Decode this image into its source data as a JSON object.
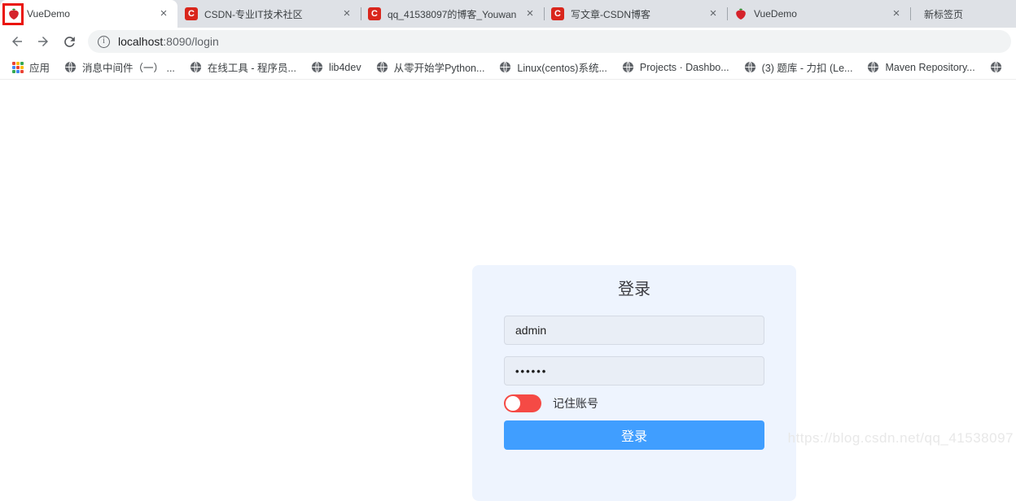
{
  "browser": {
    "tabs": [
      {
        "title": "VueDemo"
      },
      {
        "title": "CSDN-专业IT技术社区"
      },
      {
        "title": "qq_41538097的博客_Youwan"
      },
      {
        "title": "写文章-CSDN博客"
      },
      {
        "title": "VueDemo"
      },
      {
        "title": "新标签页"
      }
    ],
    "close_glyph": "×",
    "address": {
      "host": "localhost",
      "path": ":8090/login",
      "info_glyph": "i"
    },
    "bookmarks": {
      "apps_label": "应用",
      "items": [
        {
          "label": "消息中间件（一） ..."
        },
        {
          "label": "在线工具 - 程序员..."
        },
        {
          "label": "lib4dev"
        },
        {
          "label": "从零开始学Python..."
        },
        {
          "label": "Linux(centos)系统..."
        },
        {
          "label": "Projects · Dashbo..."
        },
        {
          "label": "(3) 题库 - 力扣 (Le..."
        },
        {
          "label": "Maven Repository..."
        },
        {
          "label": ""
        }
      ]
    }
  },
  "login": {
    "title": "登录",
    "username_value": "admin",
    "password_value": "••••••",
    "remember_label": "记住账号",
    "submit_label": "登录"
  },
  "watermark": "https://blog.csdn.net/qq_41538097",
  "colors": {
    "button_blue": "#409eff",
    "switch_red": "#f54a45",
    "card_bg": "#eef4fe",
    "csdn_red": "#d9261c",
    "tabstrip_bg": "#dee1e6",
    "annotation_red": "#ea130b"
  }
}
